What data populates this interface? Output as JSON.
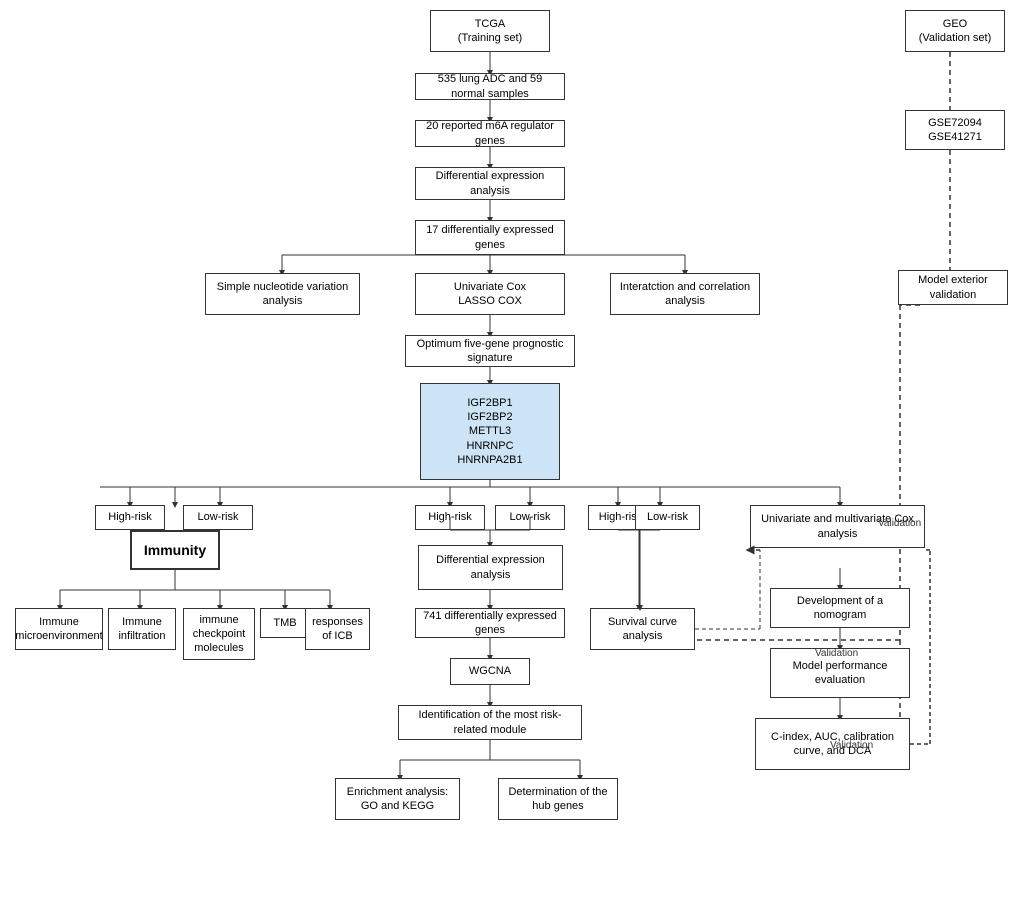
{
  "boxes": {
    "tcga": {
      "label": "TCGA\n(Training set)"
    },
    "geo": {
      "label": "GEO\n(Validation set)"
    },
    "samples535": {
      "label": "535 lung ADC and\n59 normal samples"
    },
    "m6a": {
      "label": "20 reported m6A\nregulator genes"
    },
    "diffexpr": {
      "label": "Differential expression\nanalysis"
    },
    "diff17": {
      "label": "17 differentially\nexpressed genes"
    },
    "snv": {
      "label": "Simple nucleotide\nvariation analysis"
    },
    "univcox": {
      "label": "Univariate Cox\nLASSO COX"
    },
    "interaction": {
      "label": "Interatction and\ncorrelation analysis"
    },
    "optimum": {
      "label": "Optimum five-gene\nprognostic signature"
    },
    "genes": {
      "label": "IGF2BP1\nIGF2BP2\nMETTL3\nHNRNPC\nHNRNPA2B1"
    },
    "gse": {
      "label": "GSE72094\nGSE41271"
    },
    "model_ext": {
      "label": "Model exterior\nvalidation"
    },
    "highrisk1": {
      "label": "High-risk"
    },
    "lowrisk1": {
      "label": "Low-risk"
    },
    "immunity": {
      "label": "Immunity",
      "bold": true
    },
    "immune_micro": {
      "label": "Immune\nmicroenvironment"
    },
    "immune_inf": {
      "label": "Immune\ninfiltration"
    },
    "immune_check": {
      "label": "immune\ncheckpoint\nmolecules"
    },
    "tmb": {
      "label": "TMB"
    },
    "icb": {
      "label": "responses of\nICB"
    },
    "highrisk2": {
      "label": "High-risk"
    },
    "lowrisk2": {
      "label": "Low-risk"
    },
    "diffexpr2": {
      "label": "Differential\nexpression\nanalysis"
    },
    "diff741": {
      "label": "741 differentially\nexpressed genes"
    },
    "wgcna": {
      "label": "WGCNA"
    },
    "most_risk": {
      "label": "Identification of the\nmost risk-related module"
    },
    "enrichment": {
      "label": "Enrichment analysis:\nGO and KEGG"
    },
    "hub_genes": {
      "label": "Determination of\nthe hub genes"
    },
    "highrisk3": {
      "label": "High-risk"
    },
    "lowrisk3": {
      "label": "Low-risk"
    },
    "survival": {
      "label": "Survival curve\nanalysis"
    },
    "uni_multi": {
      "label": "Univariate and multivariate\nCox analysis"
    },
    "nomogram": {
      "label": "Development of\na nomogram"
    },
    "model_perf": {
      "label": "Model performance\nevaluation"
    },
    "c_index": {
      "label": "C-index, AUC,\ncalibration curve,\nand DCA"
    },
    "validation1": {
      "label": "Validation"
    },
    "validation2": {
      "label": "Validation"
    },
    "validation3": {
      "label": "Validation"
    }
  }
}
